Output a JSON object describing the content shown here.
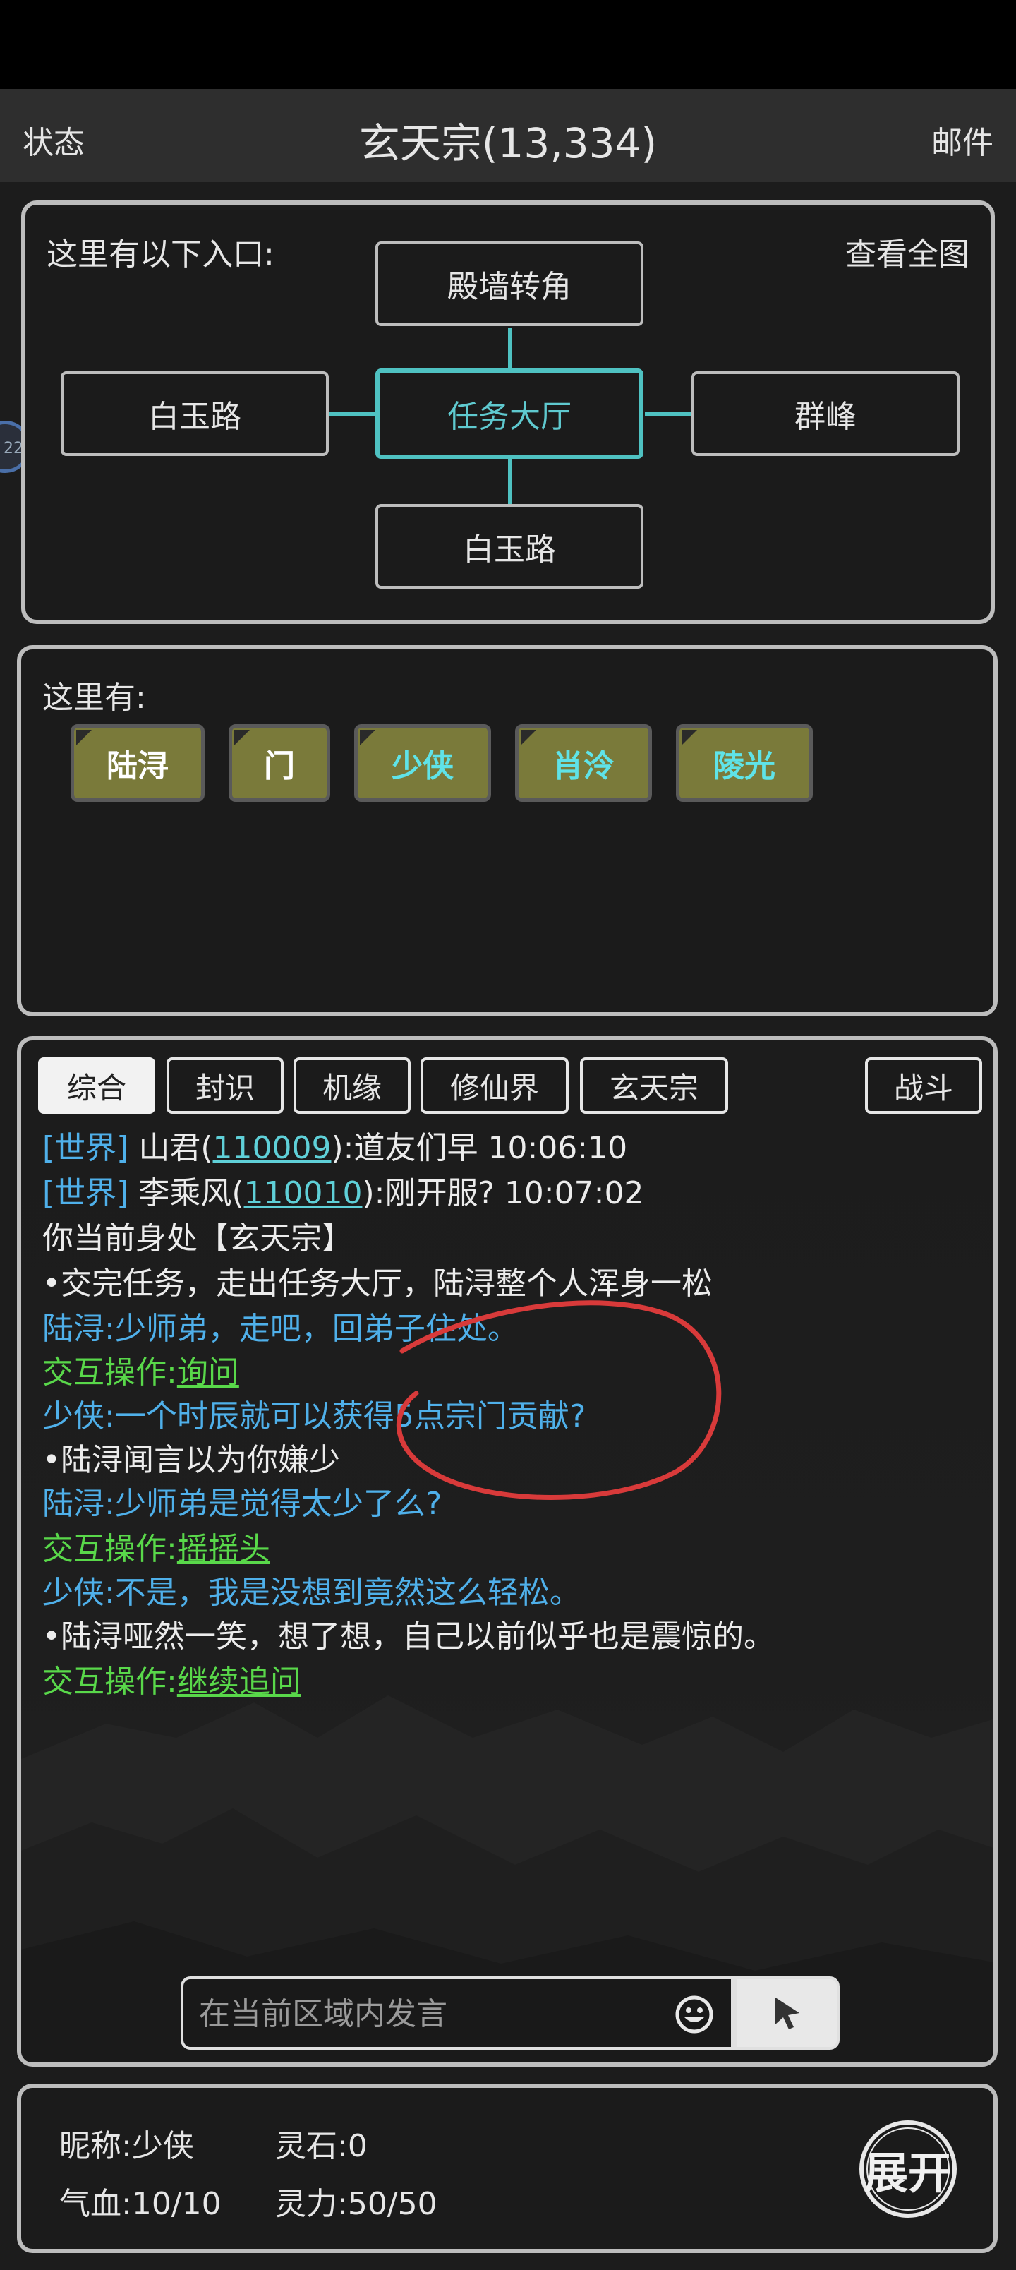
{
  "header": {
    "left": "状态",
    "title": "玄天宗(13,334)",
    "right": "邮件"
  },
  "map": {
    "label": "这里有以下入口:",
    "full_map": "查看全图",
    "north": "殿墙转角",
    "west": "白玉路",
    "center": "任务大厅",
    "east": "群峰",
    "south": "白玉路"
  },
  "entities": {
    "label": "这里有:",
    "items": [
      {
        "name": "陆浔",
        "color": "#ffffff"
      },
      {
        "name": "门",
        "color": "#ffffff"
      },
      {
        "name": "少侠",
        "color": "#5fe3e8"
      },
      {
        "name": "肖泠",
        "color": "#5fe3e8"
      },
      {
        "name": "陵光",
        "color": "#5fe3e8"
      }
    ]
  },
  "chat": {
    "tabs": [
      "综合",
      "封识",
      "机缘",
      "修仙界",
      "玄天宗"
    ],
    "battle_tab": "战斗",
    "lines": {
      "l1_prefix": "[世界]",
      "l1_name": "山君(",
      "l1_id": "110009",
      "l1_rest": "):道友们早  10:06:10",
      "l2_prefix": "[世界]",
      "l2_name": "李乘风(",
      "l2_id": "110010",
      "l2_rest": "):刚开服?  10:07:02",
      "l3": "你当前身处【玄天宗】",
      "l4": "•交完任务，走出任务大厅，陆浔整个人浑身一松",
      "l5": "陆浔:少师弟，走吧，回弟子住处。",
      "l6_label": "交互操作:",
      "l6_action": "询问",
      "l7": "少侠:一个时辰就可以获得5点宗门贡献?",
      "l8": "•陆浔闻言以为你嫌少",
      "l9": "陆浔:少师弟是觉得太少了么?",
      "l10_label": "交互操作:",
      "l10_action": "摇摇头",
      "l11": "少侠:不是，我是没想到竟然这么轻松。",
      "l12": "•陆浔哑然一笑，想了想，自己以前似乎也是震惊的。",
      "l13_label": "交互操作:",
      "l13_action": "继续追问"
    },
    "input_placeholder": "在当前区域内发言"
  },
  "player": {
    "nickname": "昵称:少侠",
    "spirit_stone": "灵石:0",
    "hp": "气血:10/10",
    "mp": "灵力:50/50",
    "expand": "展开"
  },
  "side_bubble": "22"
}
